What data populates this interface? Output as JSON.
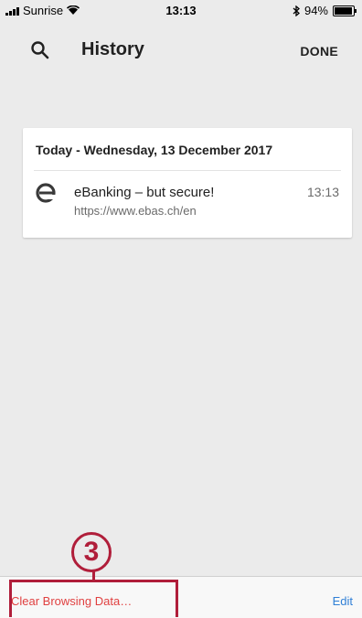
{
  "status_bar": {
    "carrier": "Sunrise",
    "time": "13:13",
    "battery": "94%",
    "battery_level": 0.94
  },
  "header": {
    "title": "History",
    "done_label": "DONE",
    "search_icon": "search-icon"
  },
  "history": {
    "section_header": "Today - Wednesday, 13 December 2017",
    "items": [
      {
        "title": "eBanking – but secure!",
        "url": "https://www.ebas.ch/en",
        "time": "13:13",
        "icon": "ebas-site-icon"
      }
    ]
  },
  "toolbar": {
    "clear_label": "Clear Browsing Data…",
    "edit_label": "Edit"
  },
  "annotation": {
    "label": "3",
    "color": "#b01e3a"
  },
  "colors": {
    "background": "#ebebeb",
    "clear_red": "#e04040",
    "edit_blue": "#2f7fd6"
  }
}
